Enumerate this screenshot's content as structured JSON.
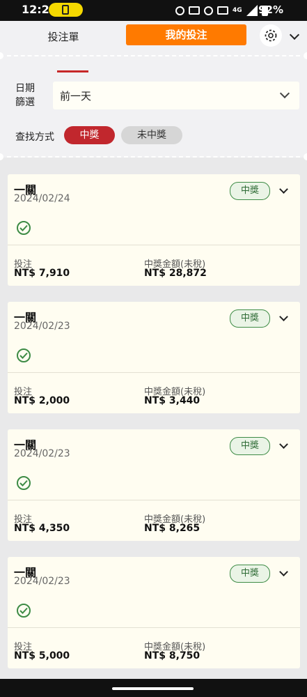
{
  "status_bar": {
    "time": "12:23",
    "battery": "92%",
    "network": "4G"
  },
  "header": {
    "tab_orders": "投注單",
    "tab_my_bets": "我的投注"
  },
  "filter": {
    "date_label": "日期篩選",
    "date_value": "前一天",
    "search_label": "查找方式",
    "win_label": "中獎",
    "lose_label": "未中獎"
  },
  "cards": [
    {
      "name": "一關",
      "date": "2024/02/24",
      "badge": "中獎",
      "stake_label": "投注",
      "stake": "NT$ 7,910",
      "win_label": "中獎金額(未稅)",
      "win": "NT$ 28,872"
    },
    {
      "name": "一關",
      "date": "2024/02/23",
      "badge": "中獎",
      "stake_label": "投注",
      "stake": "NT$ 2,000",
      "win_label": "中獎金額(未稅)",
      "win": "NT$ 3,440"
    },
    {
      "name": "一關",
      "date": "2024/02/23",
      "badge": "中獎",
      "stake_label": "投注",
      "stake": "NT$ 4,350",
      "win_label": "中獎金額(未稅)",
      "win": "NT$ 8,265"
    },
    {
      "name": "一關",
      "date": "2024/02/23",
      "badge": "中獎",
      "stake_label": "投注",
      "stake": "NT$ 5,000",
      "win_label": "中獎金額(未稅)",
      "win": "NT$ 8,750"
    }
  ],
  "colors": {
    "accent": "#ff7a00",
    "win_red": "#c1272d",
    "success": "#3d8b45"
  }
}
